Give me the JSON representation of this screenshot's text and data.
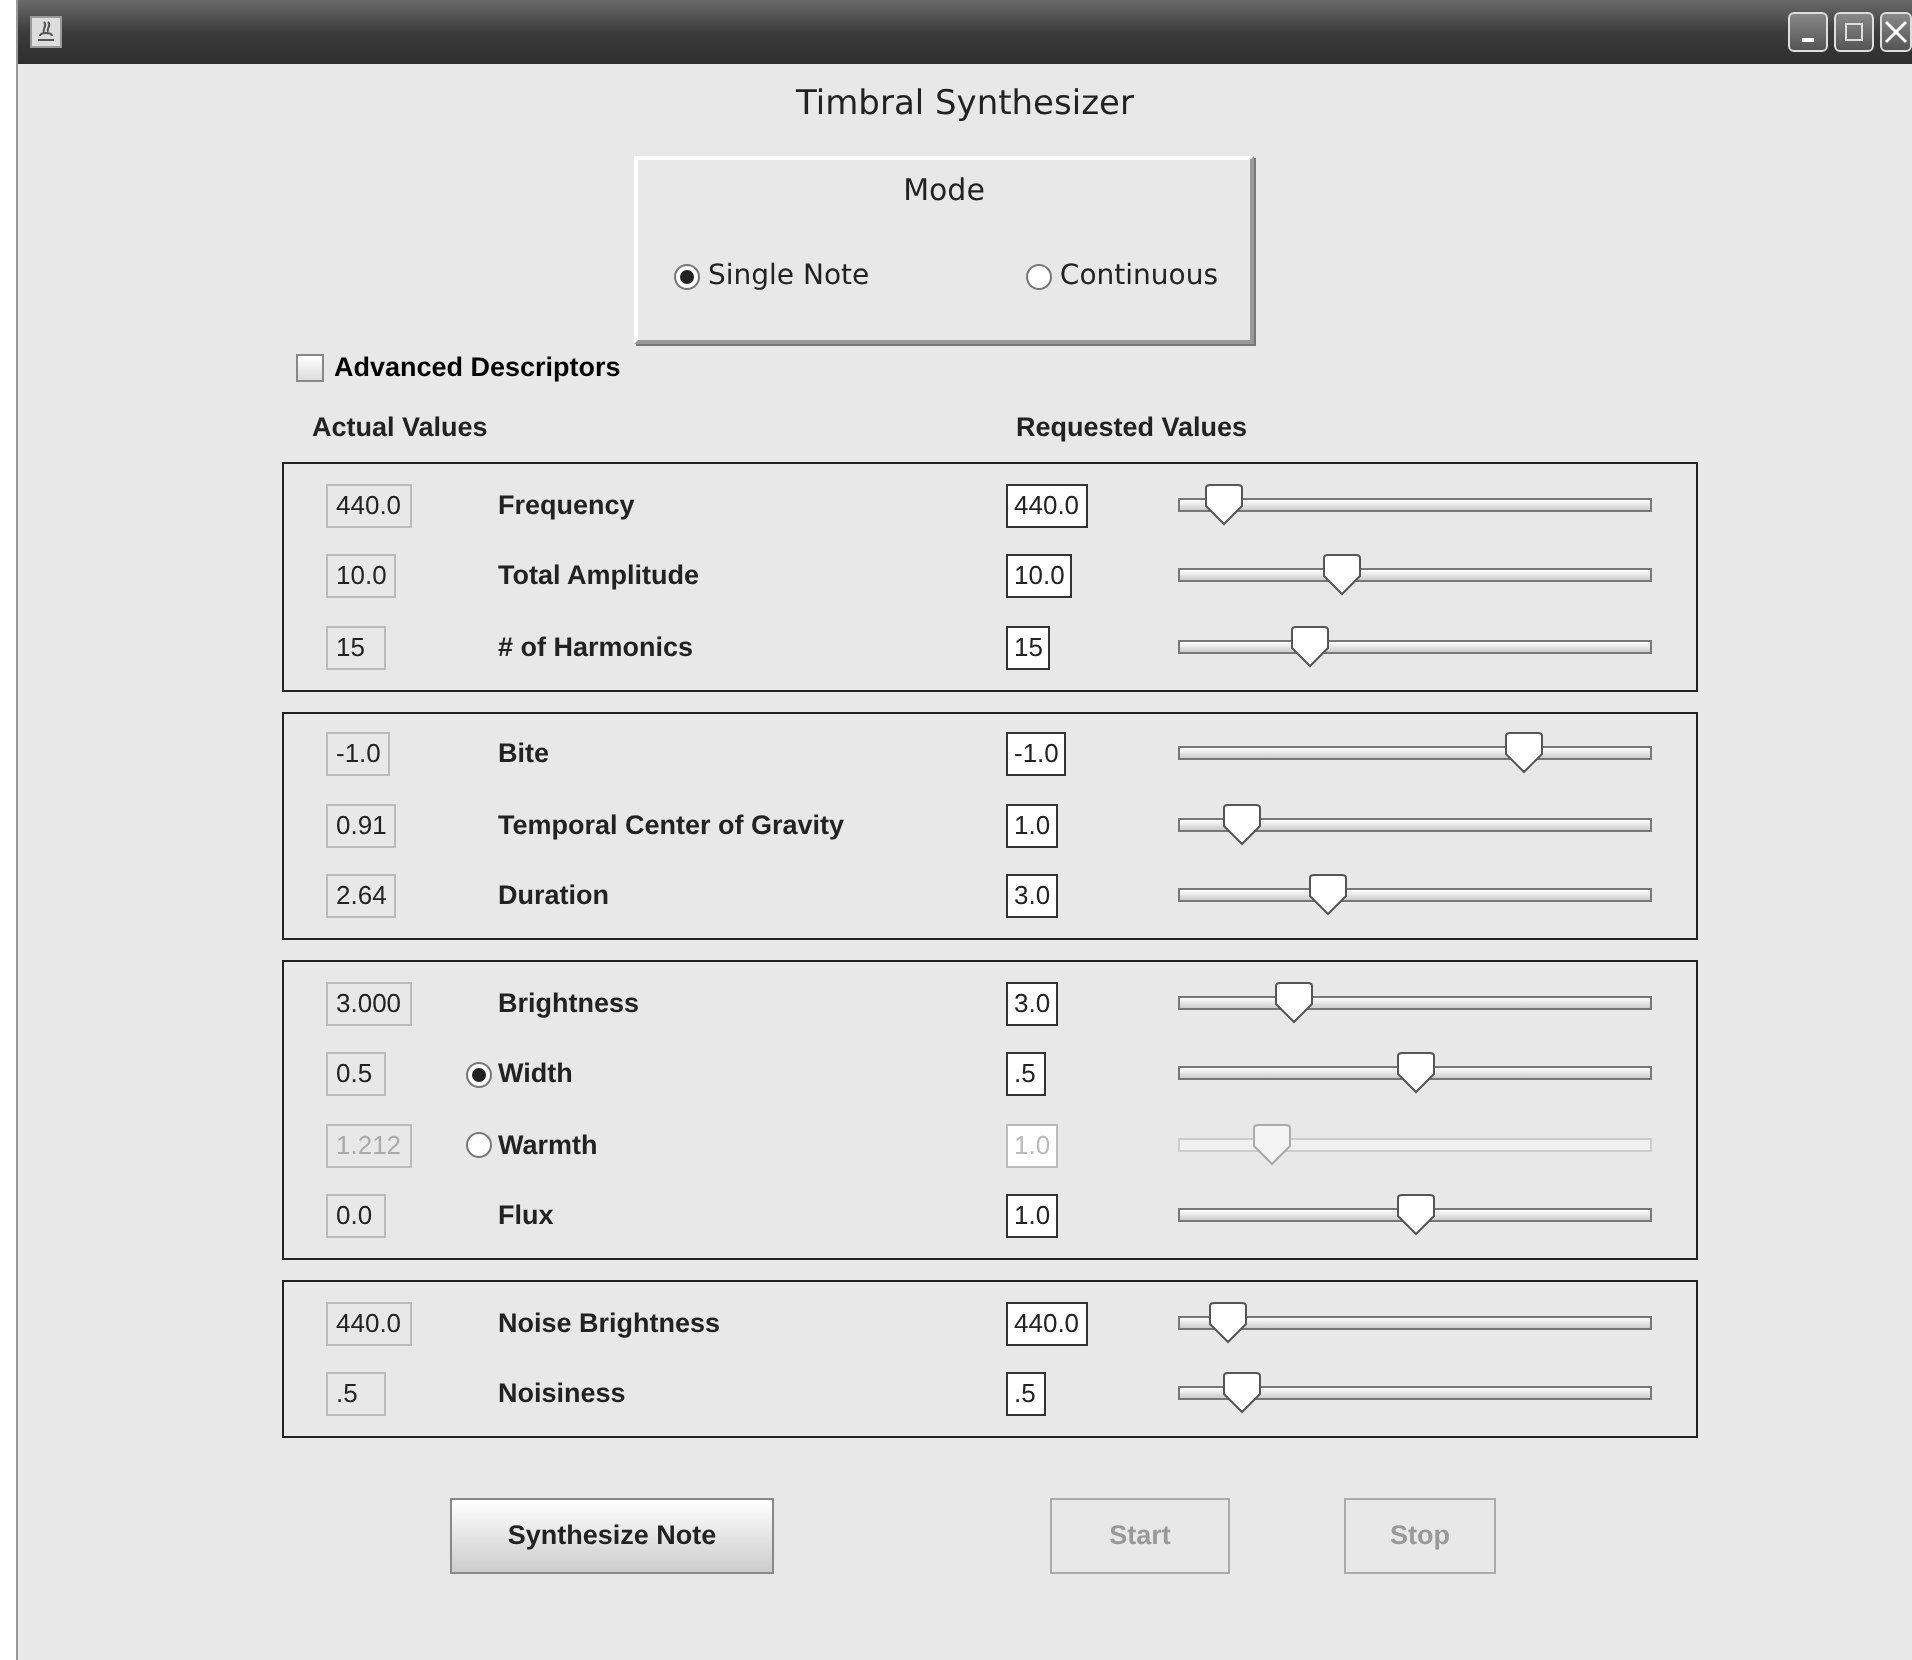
{
  "app_title": "Timbral Synthesizer",
  "mode": {
    "title": "Mode",
    "options": [
      {
        "label": "Single Note",
        "selected": true
      },
      {
        "label": "Continuous",
        "selected": false
      }
    ]
  },
  "advanced": {
    "label": "Advanced Descriptors",
    "checked": false
  },
  "headers": {
    "actual": "Actual Values",
    "requested": "Requested Values"
  },
  "groups": [
    {
      "rows": [
        {
          "kind": "plain",
          "actual": "440.0",
          "label": "Frequency",
          "requested": "440.0",
          "level": 0.06,
          "disabled": false
        },
        {
          "kind": "plain",
          "actual": "10.0",
          "label": "Total Amplitude",
          "requested": "10.0",
          "level": 0.33,
          "disabled": false
        },
        {
          "kind": "plain",
          "actual": "15",
          "label": "# of Harmonics",
          "requested": "15",
          "level": 0.26,
          "disabled": false
        }
      ]
    },
    {
      "rows": [
        {
          "kind": "plain",
          "actual": "-1.0",
          "label": "Bite",
          "requested": "-1.0",
          "level": 0.75,
          "disabled": false
        },
        {
          "kind": "plain",
          "actual": "0.91",
          "label": "Temporal Center of Gravity",
          "requested": "1.0",
          "level": 0.1,
          "disabled": false
        },
        {
          "kind": "plain",
          "actual": "2.64",
          "label": "Duration",
          "requested": "3.0",
          "level": 0.3,
          "disabled": false
        }
      ]
    },
    {
      "rows": [
        {
          "kind": "plain",
          "actual": "3.000",
          "label": "Brightness",
          "requested": "3.0",
          "level": 0.22,
          "disabled": false
        },
        {
          "kind": "radio",
          "selected": true,
          "actual": "0.5",
          "label": "Width",
          "requested": ".5",
          "level": 0.5,
          "disabled": false
        },
        {
          "kind": "radio",
          "selected": false,
          "actual": "1.212",
          "label": "Warmth",
          "requested": "1.0",
          "level": 0.17,
          "disabled": true
        },
        {
          "kind": "plain",
          "actual": "0.0",
          "label": "Flux",
          "requested": "1.0",
          "level": 0.5,
          "disabled": false
        }
      ]
    },
    {
      "rows": [
        {
          "kind": "plain",
          "actual": "440.0",
          "label": "Noise Brightness",
          "requested": "440.0",
          "level": 0.07,
          "disabled": false
        },
        {
          "kind": "plain",
          "actual": ".5",
          "label": "Noisiness",
          "requested": ".5",
          "level": 0.1,
          "disabled": false
        }
      ]
    }
  ],
  "buttons": [
    {
      "label": "Synthesize Note",
      "disabled": false
    },
    {
      "label": "Start",
      "disabled": true
    },
    {
      "label": "Stop",
      "disabled": true
    }
  ]
}
